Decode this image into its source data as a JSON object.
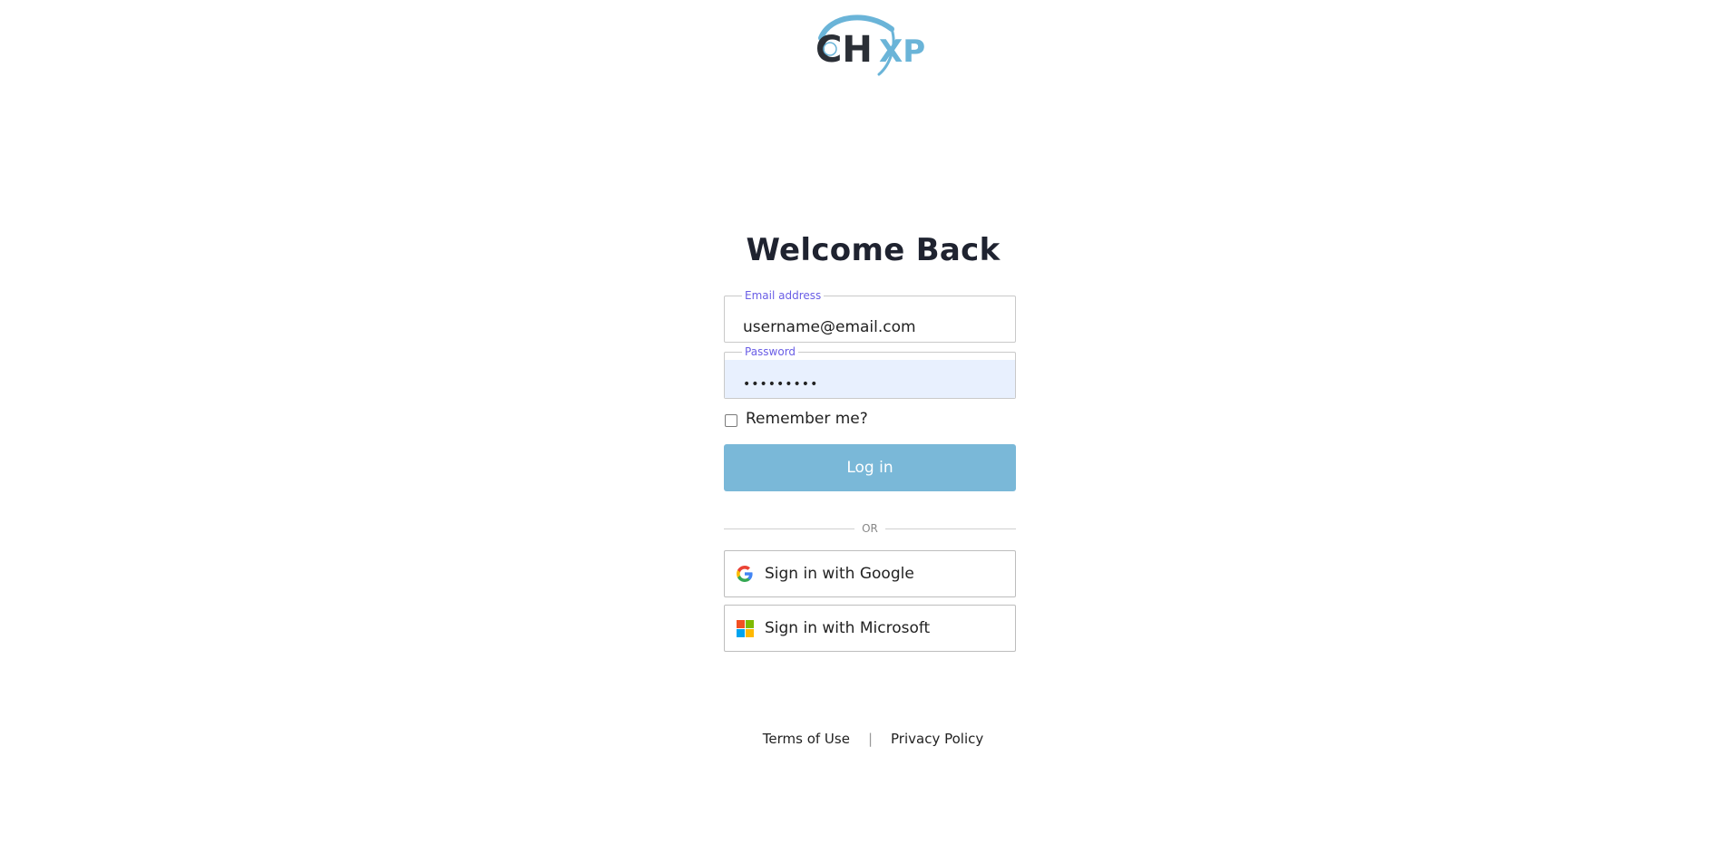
{
  "brand": {
    "logo_text": "CHXP",
    "accent_color": "#6ab4d8",
    "dark_color": "#2b2f36"
  },
  "login": {
    "title": "Welcome Back",
    "email": {
      "label": "Email address",
      "value": "username@email.com"
    },
    "password": {
      "label": "Password",
      "value": "•••••••••"
    },
    "remember_label": "Remember me?",
    "remember_checked": false,
    "submit_label": "Log in",
    "submit_color": "#7ab8d8",
    "divider_label": "OR"
  },
  "sso": [
    {
      "label": "Sign in with Google",
      "icon": "google-icon"
    },
    {
      "label": "Sign in with Microsoft",
      "icon": "microsoft-icon"
    }
  ],
  "footer": {
    "terms_label": "Terms of Use",
    "separator": "|",
    "privacy_label": "Privacy Policy"
  }
}
